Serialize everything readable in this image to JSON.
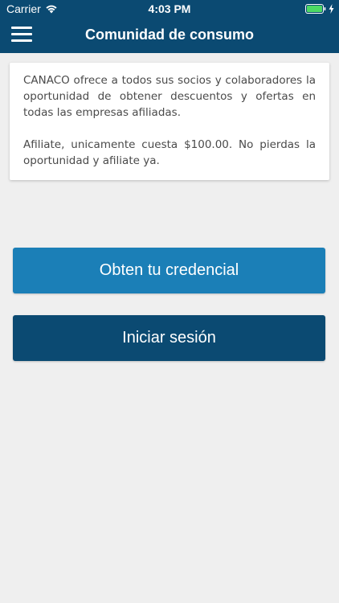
{
  "status_bar": {
    "carrier": "Carrier",
    "time": "4:03 PM",
    "wifi_icon": "wifi-icon",
    "battery_icon": "battery-icon",
    "battery_color": "#4cd964"
  },
  "navbar": {
    "title": "Comunidad de consumo",
    "menu_icon": "hamburger-menu-icon",
    "background_color": "#0b4a72"
  },
  "info_card": {
    "paragraph_1": "CANACO ofrece a todos sus socios y colaboradores la oportunidad de obtener descuentos y ofertas en todas las empresas afiliadas.",
    "paragraph_2": "Afiliate, unicamente cuesta $100.00. No pierdas la oportunidad y afiliate ya."
  },
  "buttons": {
    "get_credential_label": "Obten tu credencial",
    "get_credential_color": "#1b7fb7",
    "login_label": "Iniciar sesión",
    "login_color": "#0b4a72"
  }
}
